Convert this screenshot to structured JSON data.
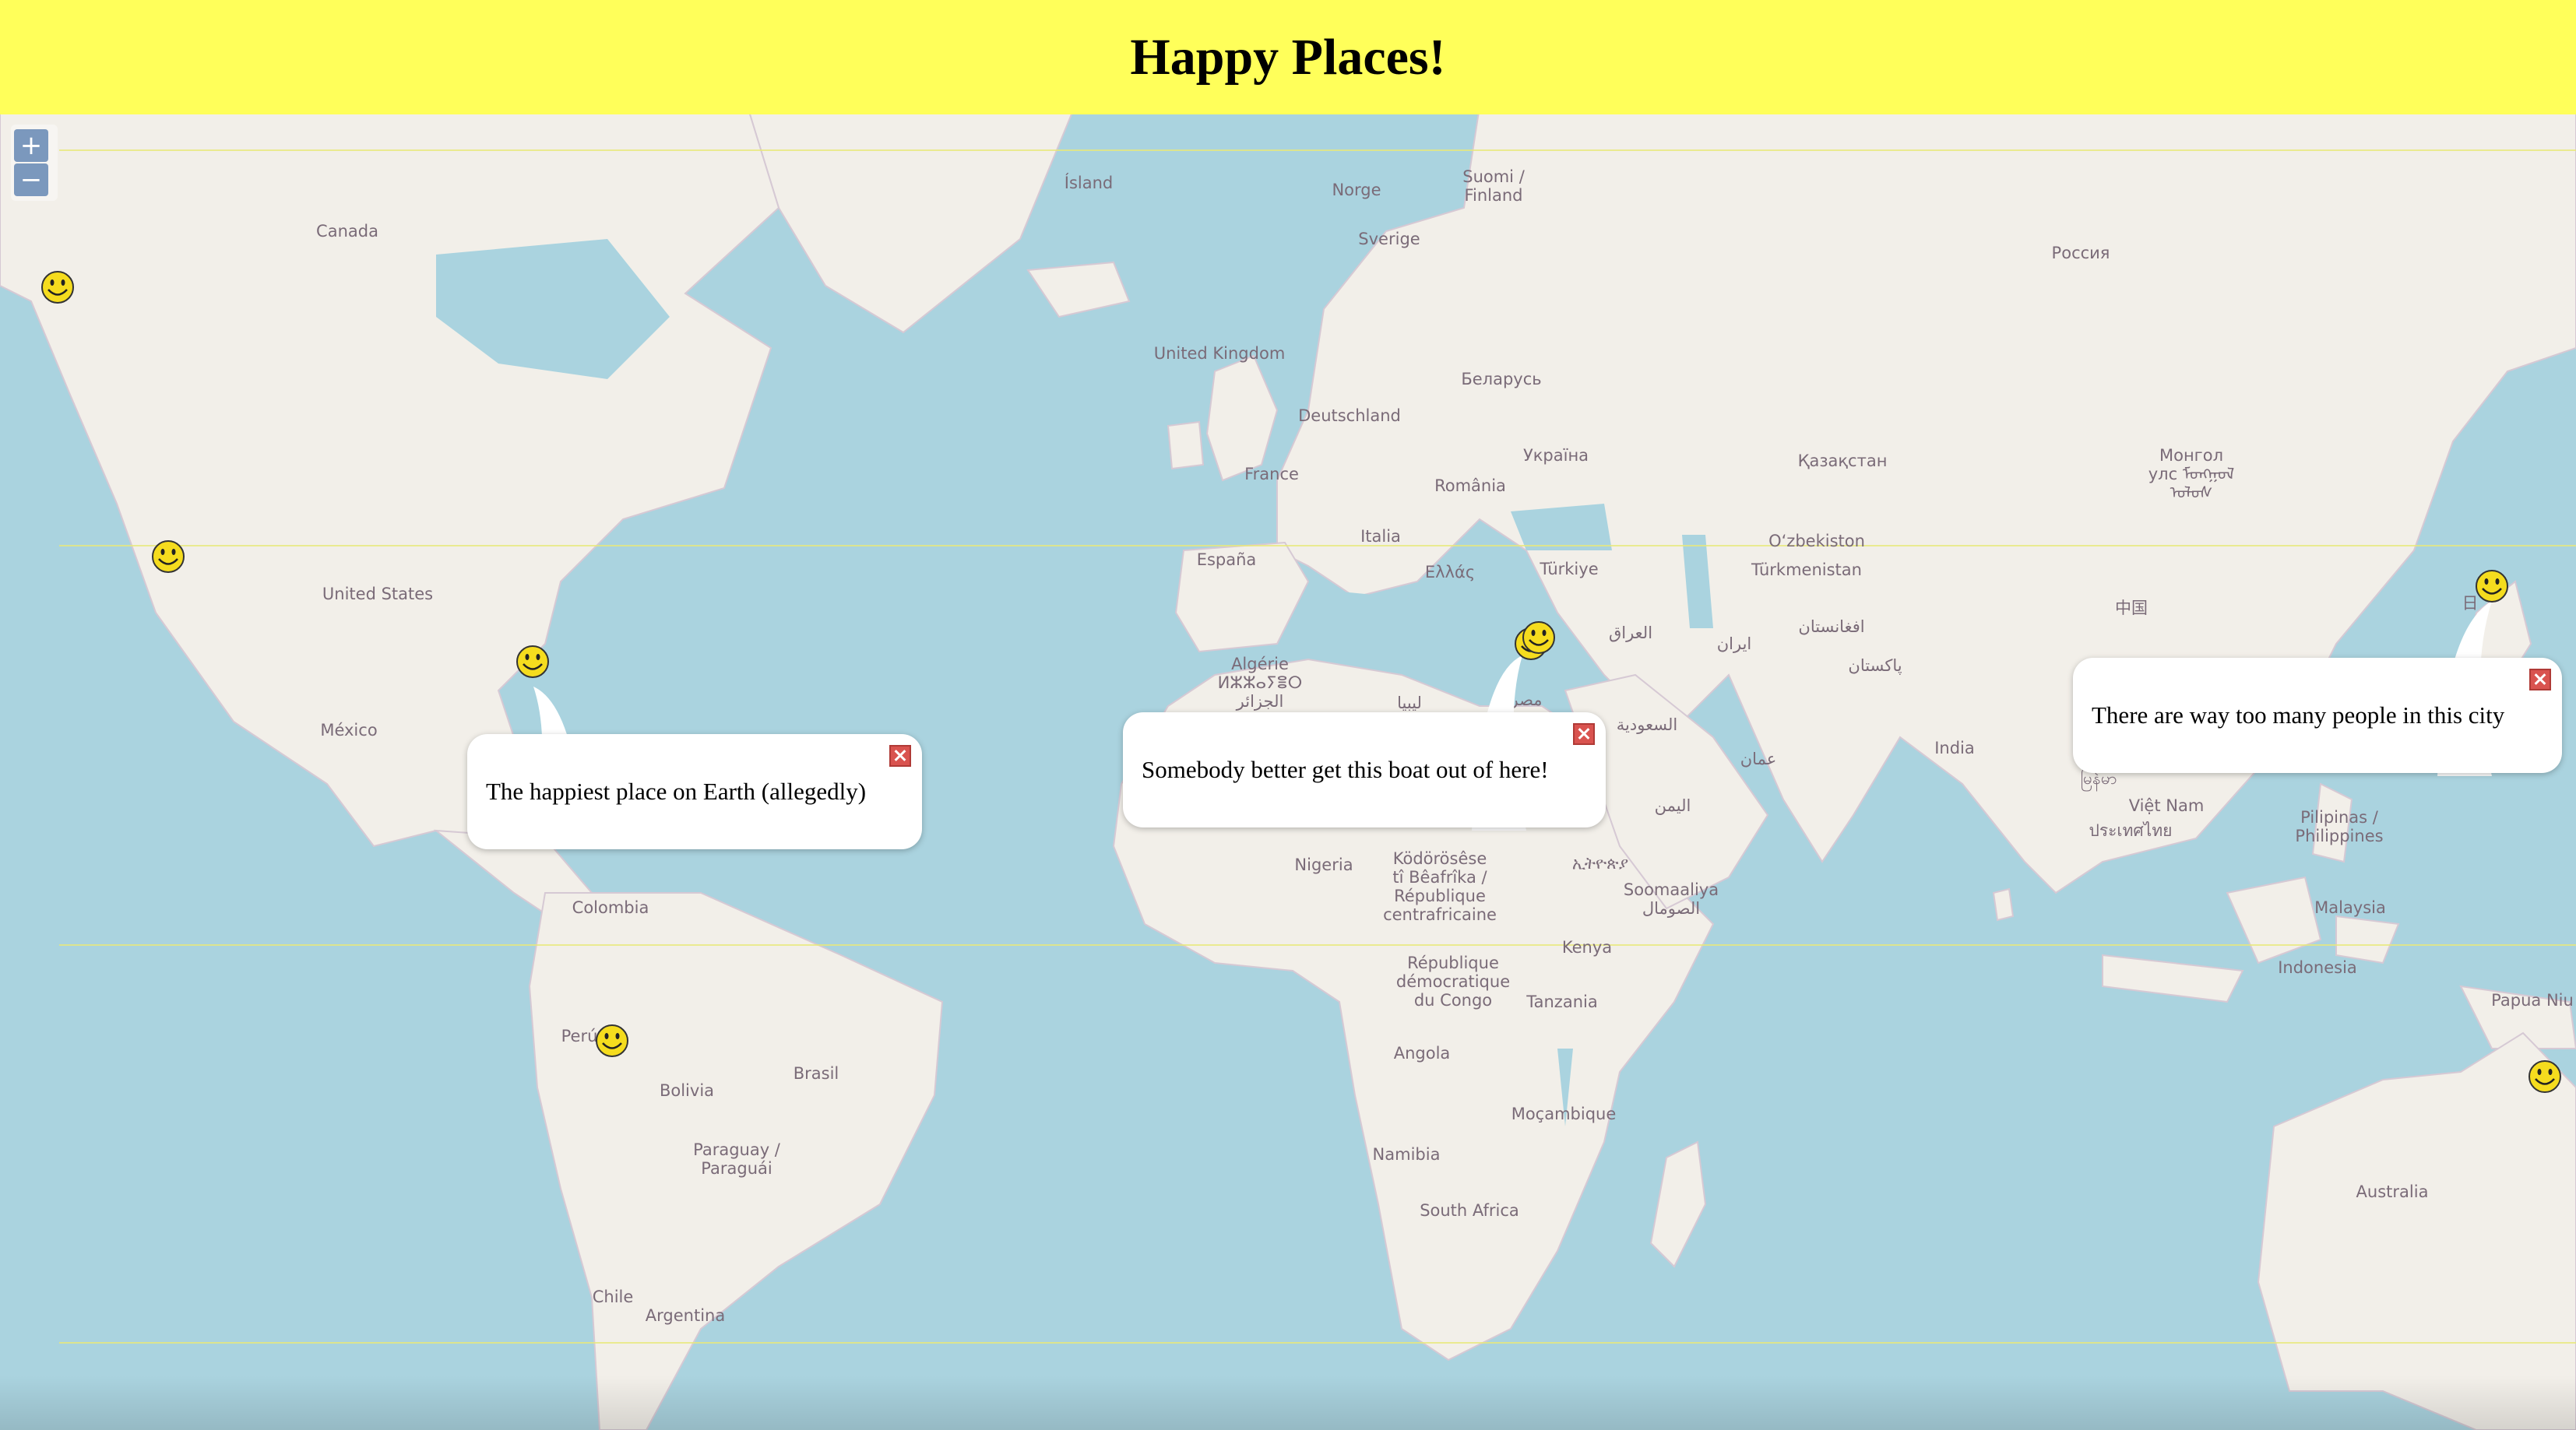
{
  "header": {
    "title": "Happy Places!"
  },
  "colors": {
    "header_bg": "#ffff5a",
    "water": "#aad3df",
    "land": "#f2efe9",
    "border": "#b9a9c6",
    "marker": "#f5dc1e"
  },
  "map": {
    "zoom_in": "+",
    "zoom_out": "−",
    "labels": {
      "canada": "Canada",
      "island": "Ísland",
      "norge": "Norge",
      "suomi": "Suomi /\nFinland",
      "sverige": "Sverige",
      "rossiya": "Россия",
      "uk": "United Kingdom",
      "belarus": "Беларусь",
      "deutschland": "Deutschland",
      "ukraina": "Україна",
      "france": "France",
      "romania": "România",
      "kazakhstan": "Қазақстан",
      "mongol": "Монгол\nулс ᠮᠣᠩᠭᠣᠯ\nᠤᠯᠤᠰ",
      "italia": "Italia",
      "uzbekiston": "O‘zbekiston",
      "espana": "España",
      "ellas": "Ελλάς",
      "turkiye": "Türkiye",
      "turkmenistan": "Türkmenistan",
      "united_states": "United States",
      "iraq": "العراق",
      "iran": "ایران",
      "afghanistan": "افغانستان",
      "zhongguo": "中国",
      "pakistan": "پاکستان",
      "nihon": "日",
      "algerie": "Algérie\nⵍⵣⵣⴰⵢⴻⵔ\nالجزائر",
      "libya": "ليبيا",
      "misr": "مصر",
      "saudi": "السعودية",
      "mexico": "México",
      "india": "India",
      "oman": "عمان",
      "yemen": "اليمن",
      "vietnam": "Việt Nam",
      "myanmar": "မြန်မာ",
      "thailand": "ประเทศไทย",
      "pilipinas": "Pilipinas /\nPhilippines",
      "nigeria": "Nigeria",
      "car": "Ködörösêse\ntî Bêafrîka /\nRépublique\ncentrafricaine",
      "ethiopia": "ኢትዮጵያ",
      "somalia": "Soomaaliya\nالصومال",
      "colombia": "Colombia",
      "malaysia": "Malaysia",
      "kenya": "Kenya",
      "rdc": "République\ndémocratique\ndu Congo",
      "indonesia": "Indonesia",
      "tanzania": "Tanzania",
      "papua": "Papua Niu",
      "peru": "Perú",
      "brasil": "Brasil",
      "bolivia": "Bolivia",
      "angola": "Angola",
      "mocambique": "Moçambique",
      "paraguay": "Paraguay /\nParaguái",
      "namibia": "Namibia",
      "australia": "Australia",
      "south_africa": "South Africa",
      "chile": "Chile",
      "argentina": "Argentina"
    },
    "popups": {
      "florida": {
        "text": "The happiest place on Earth (allegedly)"
      },
      "egypt": {
        "text": "Somebody better get this boat out of here!"
      },
      "japan": {
        "text": "There are way too many people in this city"
      }
    }
  }
}
